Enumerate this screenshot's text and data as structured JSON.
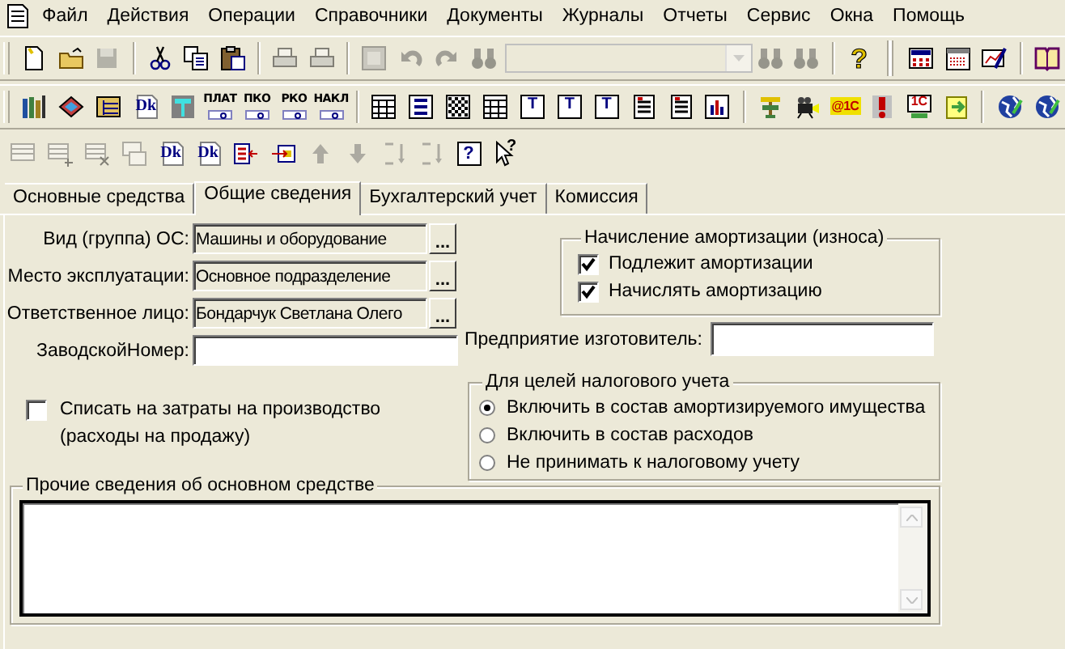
{
  "menu": [
    "Файл",
    "Действия",
    "Операции",
    "Справочники",
    "Документы",
    "Журналы",
    "Отчеты",
    "Сервис",
    "Окна",
    "Помощь"
  ],
  "toolbars": [
    {
      "items": [
        {
          "kind": "button",
          "disabled": false
        },
        {
          "kind": "button",
          "disabled": false
        },
        {
          "kind": "button",
          "disabled": true
        },
        {
          "kind": "separator"
        },
        {
          "kind": "button",
          "disabled": false
        },
        {
          "kind": "button",
          "disabled": false
        },
        {
          "kind": "button",
          "disabled": false
        },
        {
          "kind": "separator"
        },
        {
          "kind": "button",
          "disabled": true
        },
        {
          "kind": "button",
          "disabled": true
        },
        {
          "kind": "separator"
        },
        {
          "kind": "button",
          "disabled": true
        },
        {
          "kind": "button",
          "disabled": true
        },
        {
          "kind": "button",
          "disabled": true
        },
        {
          "kind": "button",
          "disabled": true
        },
        {
          "kind": "combo",
          "disabled": true
        },
        {
          "kind": "button",
          "disabled": true
        },
        {
          "kind": "button",
          "disabled": true
        },
        {
          "kind": "separator"
        },
        {
          "kind": "button",
          "disabled": false,
          "label": "?"
        },
        {
          "kind": "grip"
        },
        {
          "kind": "button",
          "disabled": false
        },
        {
          "kind": "button",
          "disabled": false
        },
        {
          "kind": "button",
          "disabled": false
        },
        {
          "kind": "separator"
        },
        {
          "kind": "button",
          "disabled": false
        }
      ]
    },
    {
      "items": [
        {
          "kind": "button",
          "disabled": false
        },
        {
          "kind": "button",
          "disabled": false
        },
        {
          "kind": "button",
          "disabled": false
        },
        {
          "kind": "button",
          "disabled": false,
          "label": "Dk"
        },
        {
          "kind": "button",
          "disabled": false
        },
        {
          "kind": "button",
          "disabled": false,
          "label": "ПЛАТ"
        },
        {
          "kind": "button",
          "disabled": false,
          "label": "ПКО"
        },
        {
          "kind": "button",
          "disabled": false,
          "label": "РКО"
        },
        {
          "kind": "button",
          "disabled": false,
          "label": "НАКЛ"
        },
        {
          "kind": "separator"
        },
        {
          "kind": "button",
          "disabled": false
        },
        {
          "kind": "button",
          "disabled": false
        },
        {
          "kind": "button",
          "disabled": false
        },
        {
          "kind": "button",
          "disabled": false
        },
        {
          "kind": "button",
          "disabled": false,
          "label": "T"
        },
        {
          "kind": "button",
          "disabled": false,
          "label": "T"
        },
        {
          "kind": "button",
          "disabled": false,
          "label": "T"
        },
        {
          "kind": "button",
          "disabled": false
        },
        {
          "kind": "button",
          "disabled": false
        },
        {
          "kind": "button",
          "disabled": false
        },
        {
          "kind": "separator"
        },
        {
          "kind": "button",
          "disabled": false
        },
        {
          "kind": "button",
          "disabled": false
        },
        {
          "kind": "button",
          "disabled": false,
          "label": "@1С"
        },
        {
          "kind": "button",
          "disabled": false
        },
        {
          "kind": "button",
          "disabled": false,
          "label": "1С"
        },
        {
          "kind": "button",
          "disabled": false
        },
        {
          "kind": "separator"
        },
        {
          "kind": "button",
          "disabled": false
        },
        {
          "kind": "button",
          "disabled": false
        }
      ]
    },
    {
      "items": [
        {
          "kind": "button",
          "disabled": true
        },
        {
          "kind": "button",
          "disabled": true
        },
        {
          "kind": "button",
          "disabled": true
        },
        {
          "kind": "button",
          "disabled": true
        },
        {
          "kind": "button",
          "disabled": false,
          "label": "Dk"
        },
        {
          "kind": "button",
          "disabled": false,
          "label": "Dk"
        },
        {
          "kind": "button",
          "disabled": false
        },
        {
          "kind": "button",
          "disabled": false
        },
        {
          "kind": "button",
          "disabled": true
        },
        {
          "kind": "button",
          "disabled": true
        },
        {
          "kind": "button",
          "disabled": true
        },
        {
          "kind": "button",
          "disabled": true
        },
        {
          "kind": "button",
          "disabled": false,
          "label": "?"
        },
        {
          "kind": "button",
          "disabled": false,
          "label": "?"
        }
      ]
    }
  ],
  "tabs": [
    {
      "label": "Основные средства",
      "selected": false
    },
    {
      "label": "Общие сведения",
      "selected": true
    },
    {
      "label": "Бухгалтерский учет",
      "selected": false
    },
    {
      "label": "Комиссия",
      "selected": false
    }
  ],
  "fields": [
    {
      "label": "Вид (группа) ОС:",
      "kind": "picker",
      "value": "Машины и оборудование",
      "button": "..."
    },
    {
      "label": "Место эксплуатации:",
      "kind": "picker",
      "value": "Основное подразделение",
      "button": "..."
    },
    {
      "label": "Ответственное лицо:",
      "kind": "picker",
      "value": "Бондарчук Светлана Олего",
      "button": "..."
    },
    {
      "label": "ЗаводскойНомер:",
      "kind": "text"
    }
  ],
  "write_off": {
    "label": "Списать на затраты на производство (расходы на продажу)",
    "checked": false
  },
  "depreciation": {
    "title": "Начисление амортизации (износа)",
    "options": [
      {
        "label": "Подлежит амортизации",
        "checked": true
      },
      {
        "label": "Начислять амортизацию",
        "checked": true
      }
    ]
  },
  "manufacturer": {
    "label": "Предприятие изготовитель:"
  },
  "tax": {
    "title": "Для целей налогового учета",
    "options": [
      {
        "label": "Включить в состав амортизируемого имущества",
        "selected": true
      },
      {
        "label": "Включить в состав расходов",
        "selected": false
      },
      {
        "label": "Не принимать к налоговому учету",
        "selected": false
      }
    ]
  },
  "notes": {
    "title": "Прочие сведения об основном средстве"
  }
}
